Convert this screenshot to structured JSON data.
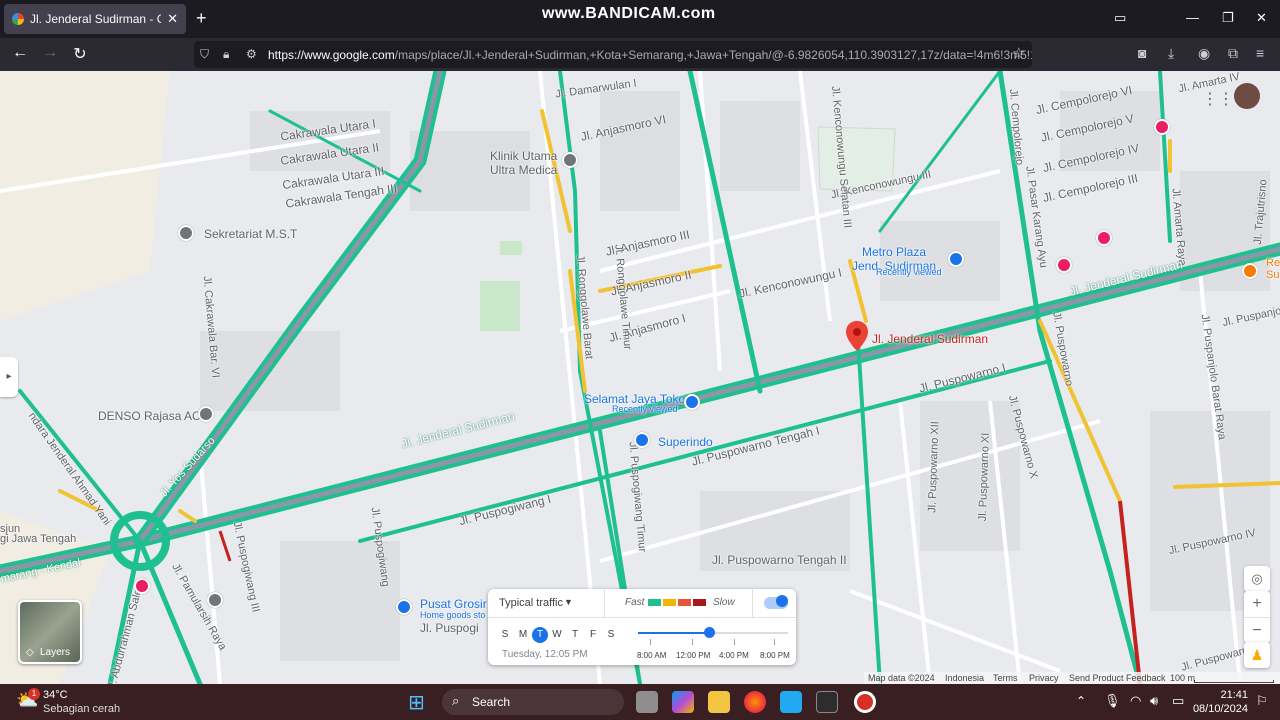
{
  "browser": {
    "tab_title": "Jl. Jenderal Sudirman - Google Maps",
    "watermark": "www.BANDICAM.com",
    "url_host": "https://www.google.com",
    "url_path": "/maps/place/Jl.+Jenderal+Sudirman,+Kota+Semarang,+Jawa+Tengah/@-6.9826054,110.3903127,17z/data=!4m6!3m5!1"
  },
  "map": {
    "streets": [
      {
        "text": "Jl. Damarwulan I"
      },
      {
        "text": "Jl. Anjasmoro VI"
      },
      {
        "text": "Jl. Anjasmoro III"
      },
      {
        "text": "Jl. Anjasmoro II"
      },
      {
        "text": "Jl. Anjasmoro I"
      },
      {
        "text": "Jl. Kenconowungu III"
      },
      {
        "text": "Jl. Kenconowungu I"
      },
      {
        "text": "Jl. Kenconowungu Selatan III"
      },
      {
        "text": "Jl. Cempolorejo"
      },
      {
        "text": "Jl. Cempolorejo VI"
      },
      {
        "text": "Jl. Cempolorejo V"
      },
      {
        "text": "Jl. Cempolorejo IV"
      },
      {
        "text": "Jl. Cempolorejo III"
      },
      {
        "text": "Jl. Amarta IV"
      },
      {
        "text": "Jl. Amarta Raya"
      },
      {
        "text": "Jl. Pasar Karang Ayu"
      },
      {
        "text": "Jl. Trajutrisno"
      },
      {
        "text": "Jl. Jenderal Sudirman"
      },
      {
        "text": "Jl. Jenderal Sudirman"
      },
      {
        "text": "Jl. Puspanjolo Barat Raya"
      },
      {
        "text": "Jl. Puspanjo"
      },
      {
        "text": "Jl. Puspowarno"
      },
      {
        "text": "Jl. Puspowarno I"
      },
      {
        "text": "Jl. Puspowarno Tengah I"
      },
      {
        "text": "Jl. Puspowarno Tengah II"
      },
      {
        "text": "Jl. Puspowarno XII"
      },
      {
        "text": "Jl. Puspowarno XI"
      },
      {
        "text": "Jl. Puspowarno X"
      },
      {
        "text": "Jl. Puspowarno IV"
      },
      {
        "text": "Jl. Puspowarno II"
      },
      {
        "text": "Jl. Ronggolawe Timur"
      },
      {
        "text": "Jl. Ronggolawe Barat"
      },
      {
        "text": "Jl. Puspogiwang Timur"
      },
      {
        "text": "Jl. Puspogiwang I"
      },
      {
        "text": "Jl. Puspogiwang"
      },
      {
        "text": "Jl. Puspogiwang III"
      },
      {
        "text": "Jl. Puspogi"
      },
      {
        "text": "Jl. Yos Sudarso"
      },
      {
        "text": "Jl. Pamularsih Raya"
      },
      {
        "text": "Jl. Cakrawala Bar. VI"
      },
      {
        "text": "Cakrawala Utara I"
      },
      {
        "text": "Cakrawala Utara II"
      },
      {
        "text": "Cakrawala Utara III"
      },
      {
        "text": "Cakrawala Tengah III"
      },
      {
        "text": "ndara Jenderal Ahmad Yani"
      },
      {
        "text": "sjun"
      },
      {
        "text": "gi Jawa Tengah"
      },
      {
        "text": "marang - Kendal"
      },
      {
        "text": "Jl. Abdurrahman Saleh"
      }
    ],
    "pois": [
      {
        "name": "Klinik Utama\nUltra Medica",
        "sub": "",
        "icon": "medical-pin"
      },
      {
        "name": "Sekretariat M.S.T",
        "sub": "",
        "icon": "place-pin"
      },
      {
        "name": "Metro Plaza\nJend. Sudirman",
        "sub": "Recently viewed",
        "icon": "shopping-pin"
      },
      {
        "name": "Jl. Jenderal Sudirman",
        "sub": "",
        "icon": "red-location-pin"
      },
      {
        "name": "Selamat Jaya Toko",
        "sub": "Recently viewed",
        "icon": "shopping-pin"
      },
      {
        "name": "Superindo",
        "sub": "",
        "icon": "cart-pin"
      },
      {
        "name": "DENSO Rajasa AC",
        "sub": "",
        "icon": "place-pin"
      },
      {
        "name": "Pusat Grosir",
        "sub": "Home goods sto",
        "icon": "shopping-pin"
      },
      {
        "name": "Re\nSu",
        "sub": "",
        "icon": "restaurant-pin"
      }
    ],
    "layers_label": "Layers",
    "traffic": {
      "mode": "Typical traffic",
      "fast": "Fast",
      "slow": "Slow",
      "days": [
        "S",
        "M",
        "T",
        "W",
        "T",
        "F",
        "S"
      ],
      "active_day": "T",
      "time": "Tuesday, 12:05 PM",
      "ticks": [
        "8:00 AM",
        "12:00 PM",
        "4:00 PM",
        "8:00 PM"
      ],
      "slider_fraction": 0.47,
      "colors": [
        "#1ec08f",
        "#f4b400",
        "#e8553a",
        "#a8191d"
      ]
    },
    "footer": [
      "Map data ©2024",
      "Indonesia",
      "Terms",
      "Privacy",
      "Send Product Feedback",
      "100 m"
    ]
  },
  "taskbar": {
    "temp": "34°C",
    "weather": "Sebagian cerah",
    "search": "Search",
    "time": "21:41",
    "date": "08/10/2024",
    "weather_badge": "1"
  },
  "colors": {
    "road_green": "#1ec08f",
    "road_yellow": "#f1c232",
    "road_red": "#c5221f",
    "map_bg": "#e8eaed"
  }
}
